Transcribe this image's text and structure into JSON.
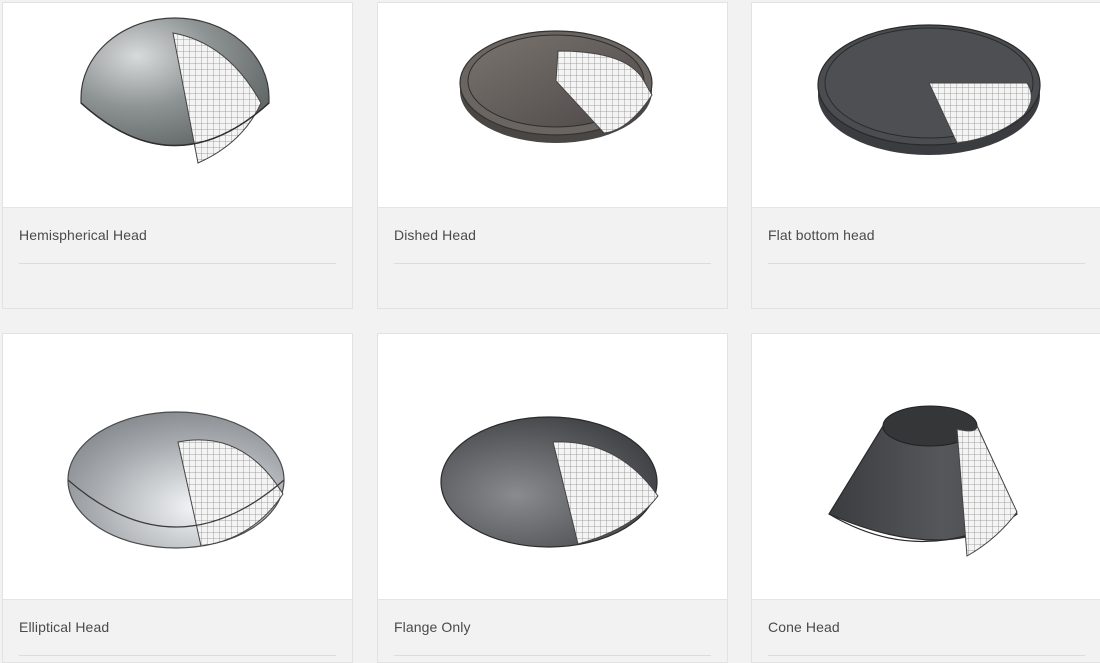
{
  "cards": [
    {
      "title": "Hemispherical Head",
      "icon": "hemispherical-head-icon"
    },
    {
      "title": "Dished Head",
      "icon": "dished-head-icon"
    },
    {
      "title": "Flat bottom head",
      "icon": "flat-bottom-head-icon"
    },
    {
      "title": "Elliptical Head",
      "icon": "elliptical-head-icon"
    },
    {
      "title": "Flange Only",
      "icon": "flange-only-icon"
    },
    {
      "title": "Cone Head",
      "icon": "cone-head-icon"
    }
  ],
  "colors": {
    "page_background": "#f2f2f2",
    "card_background": "#ffffff",
    "caption_background": "#f2f2f2",
    "title_text": "#4a4a4a"
  }
}
